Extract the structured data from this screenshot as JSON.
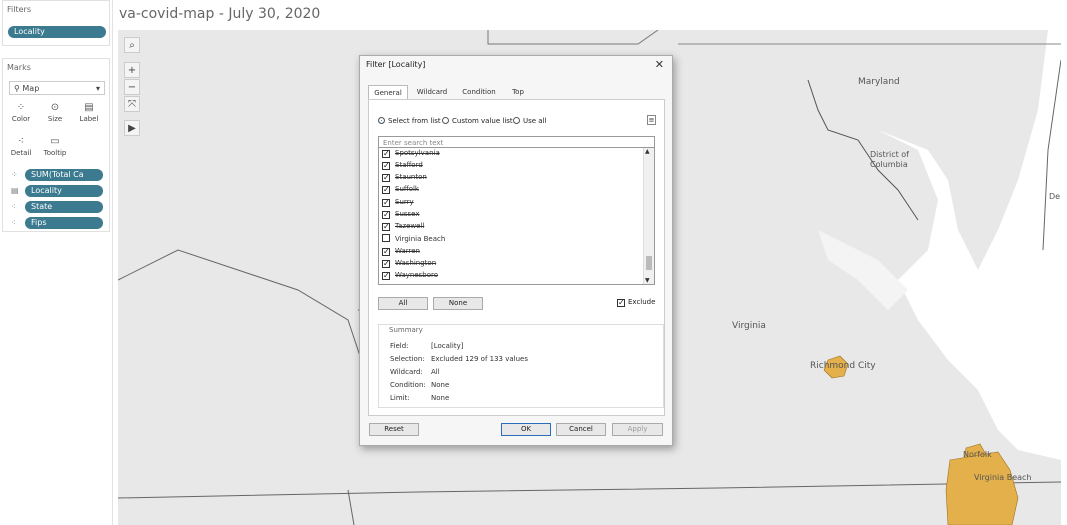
{
  "filters": {
    "title": "Filters",
    "pill": "Locality"
  },
  "marks": {
    "title": "Marks",
    "type": "Map",
    "buttons": {
      "color": "Color",
      "size": "Size",
      "label": "Label",
      "detail": "Detail",
      "tooltip": "Tooltip"
    },
    "fields": [
      "SUM(Total Ca",
      "Locality",
      "State",
      "Fips"
    ]
  },
  "sheet_title": "va-covid-map - July 30, 2020",
  "map_tools": {
    "search": "⌕",
    "zoom_in": "+",
    "zoom_out": "−",
    "pin": "⤧",
    "play": "▶"
  },
  "map_labels": {
    "maryland": "Maryland",
    "dc": "District of Columbia",
    "virginia": "Virginia",
    "richmond": "Richmond City",
    "norfolk": "Norfolk",
    "virginia_beach": "Virginia Beach",
    "de": "De"
  },
  "colors": {
    "pill": "#3b7a8f",
    "water": "#ffffff",
    "land": "#e8e8e8",
    "highlight": "#e3b04b"
  },
  "dialog": {
    "title": "Filter [Locality]",
    "close": "✕",
    "tabs": [
      "General",
      "Wildcard",
      "Condition",
      "Top"
    ],
    "radios": [
      "Select from list",
      "Custom value list",
      "Use all"
    ],
    "search_placeholder": "Enter search text",
    "items": [
      {
        "label": "Spotsylvania",
        "checked": true,
        "strike": true
      },
      {
        "label": "Stafford",
        "checked": true,
        "strike": true
      },
      {
        "label": "Staunton",
        "checked": true,
        "strike": true
      },
      {
        "label": "Suffolk",
        "checked": true,
        "strike": true
      },
      {
        "label": "Surry",
        "checked": true,
        "strike": true
      },
      {
        "label": "Sussex",
        "checked": true,
        "strike": true
      },
      {
        "label": "Tazewell",
        "checked": true,
        "strike": true
      },
      {
        "label": "Virginia Beach",
        "checked": false,
        "strike": false
      },
      {
        "label": "Warren",
        "checked": true,
        "strike": true
      },
      {
        "label": "Washington",
        "checked": true,
        "strike": true
      },
      {
        "label": "Waynesboro",
        "checked": true,
        "strike": true
      }
    ],
    "all_button": "All",
    "none_button": "None",
    "exclude_label": "Exclude",
    "summary": {
      "title": "Summary",
      "rows": [
        {
          "k": "Field:",
          "v": "[Locality]"
        },
        {
          "k": "Selection:",
          "v": "Excluded 129 of 133 values"
        },
        {
          "k": "Wildcard:",
          "v": "All"
        },
        {
          "k": "Condition:",
          "v": "None"
        },
        {
          "k": "Limit:",
          "v": "None"
        }
      ]
    },
    "reset": "Reset",
    "ok": "OK",
    "cancel": "Cancel",
    "apply": "Apply"
  }
}
